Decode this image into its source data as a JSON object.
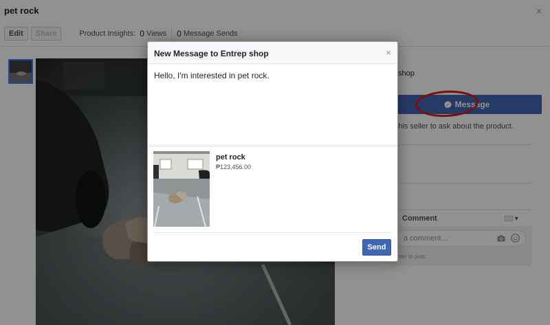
{
  "page": {
    "title": "pet rock",
    "close": "×"
  },
  "toolbar": {
    "edit_label": "Edit",
    "share_label": "Share",
    "insights_label": "Product Insights:",
    "views_count": "0",
    "views_label": "Views",
    "message_sends_count": "0",
    "message_sends_label": "Message Sends"
  },
  "seller_panel": {
    "seller_name_partial": "shop",
    "message_button_label": "Message",
    "contact_text_partial": "e this seller to ask about the product.",
    "section_partial": "s",
    "comment_tab_label": "Comment",
    "comment_placeholder_partial": "a comment...",
    "enter_note_partial": "nter to post."
  },
  "modal": {
    "title": "New Message to Entrep shop",
    "close": "×",
    "message_text": "Hello, I'm interested in pet rock.",
    "product_name": "pet rock",
    "product_price": "₱123,456.00",
    "send_label": "Send"
  },
  "colors": {
    "brand_blue": "#4267b2",
    "annotation_red": "#e0161b"
  },
  "icons": {
    "messenger": "messenger-icon",
    "camera": "camera-icon",
    "emoji": "smile-icon"
  }
}
